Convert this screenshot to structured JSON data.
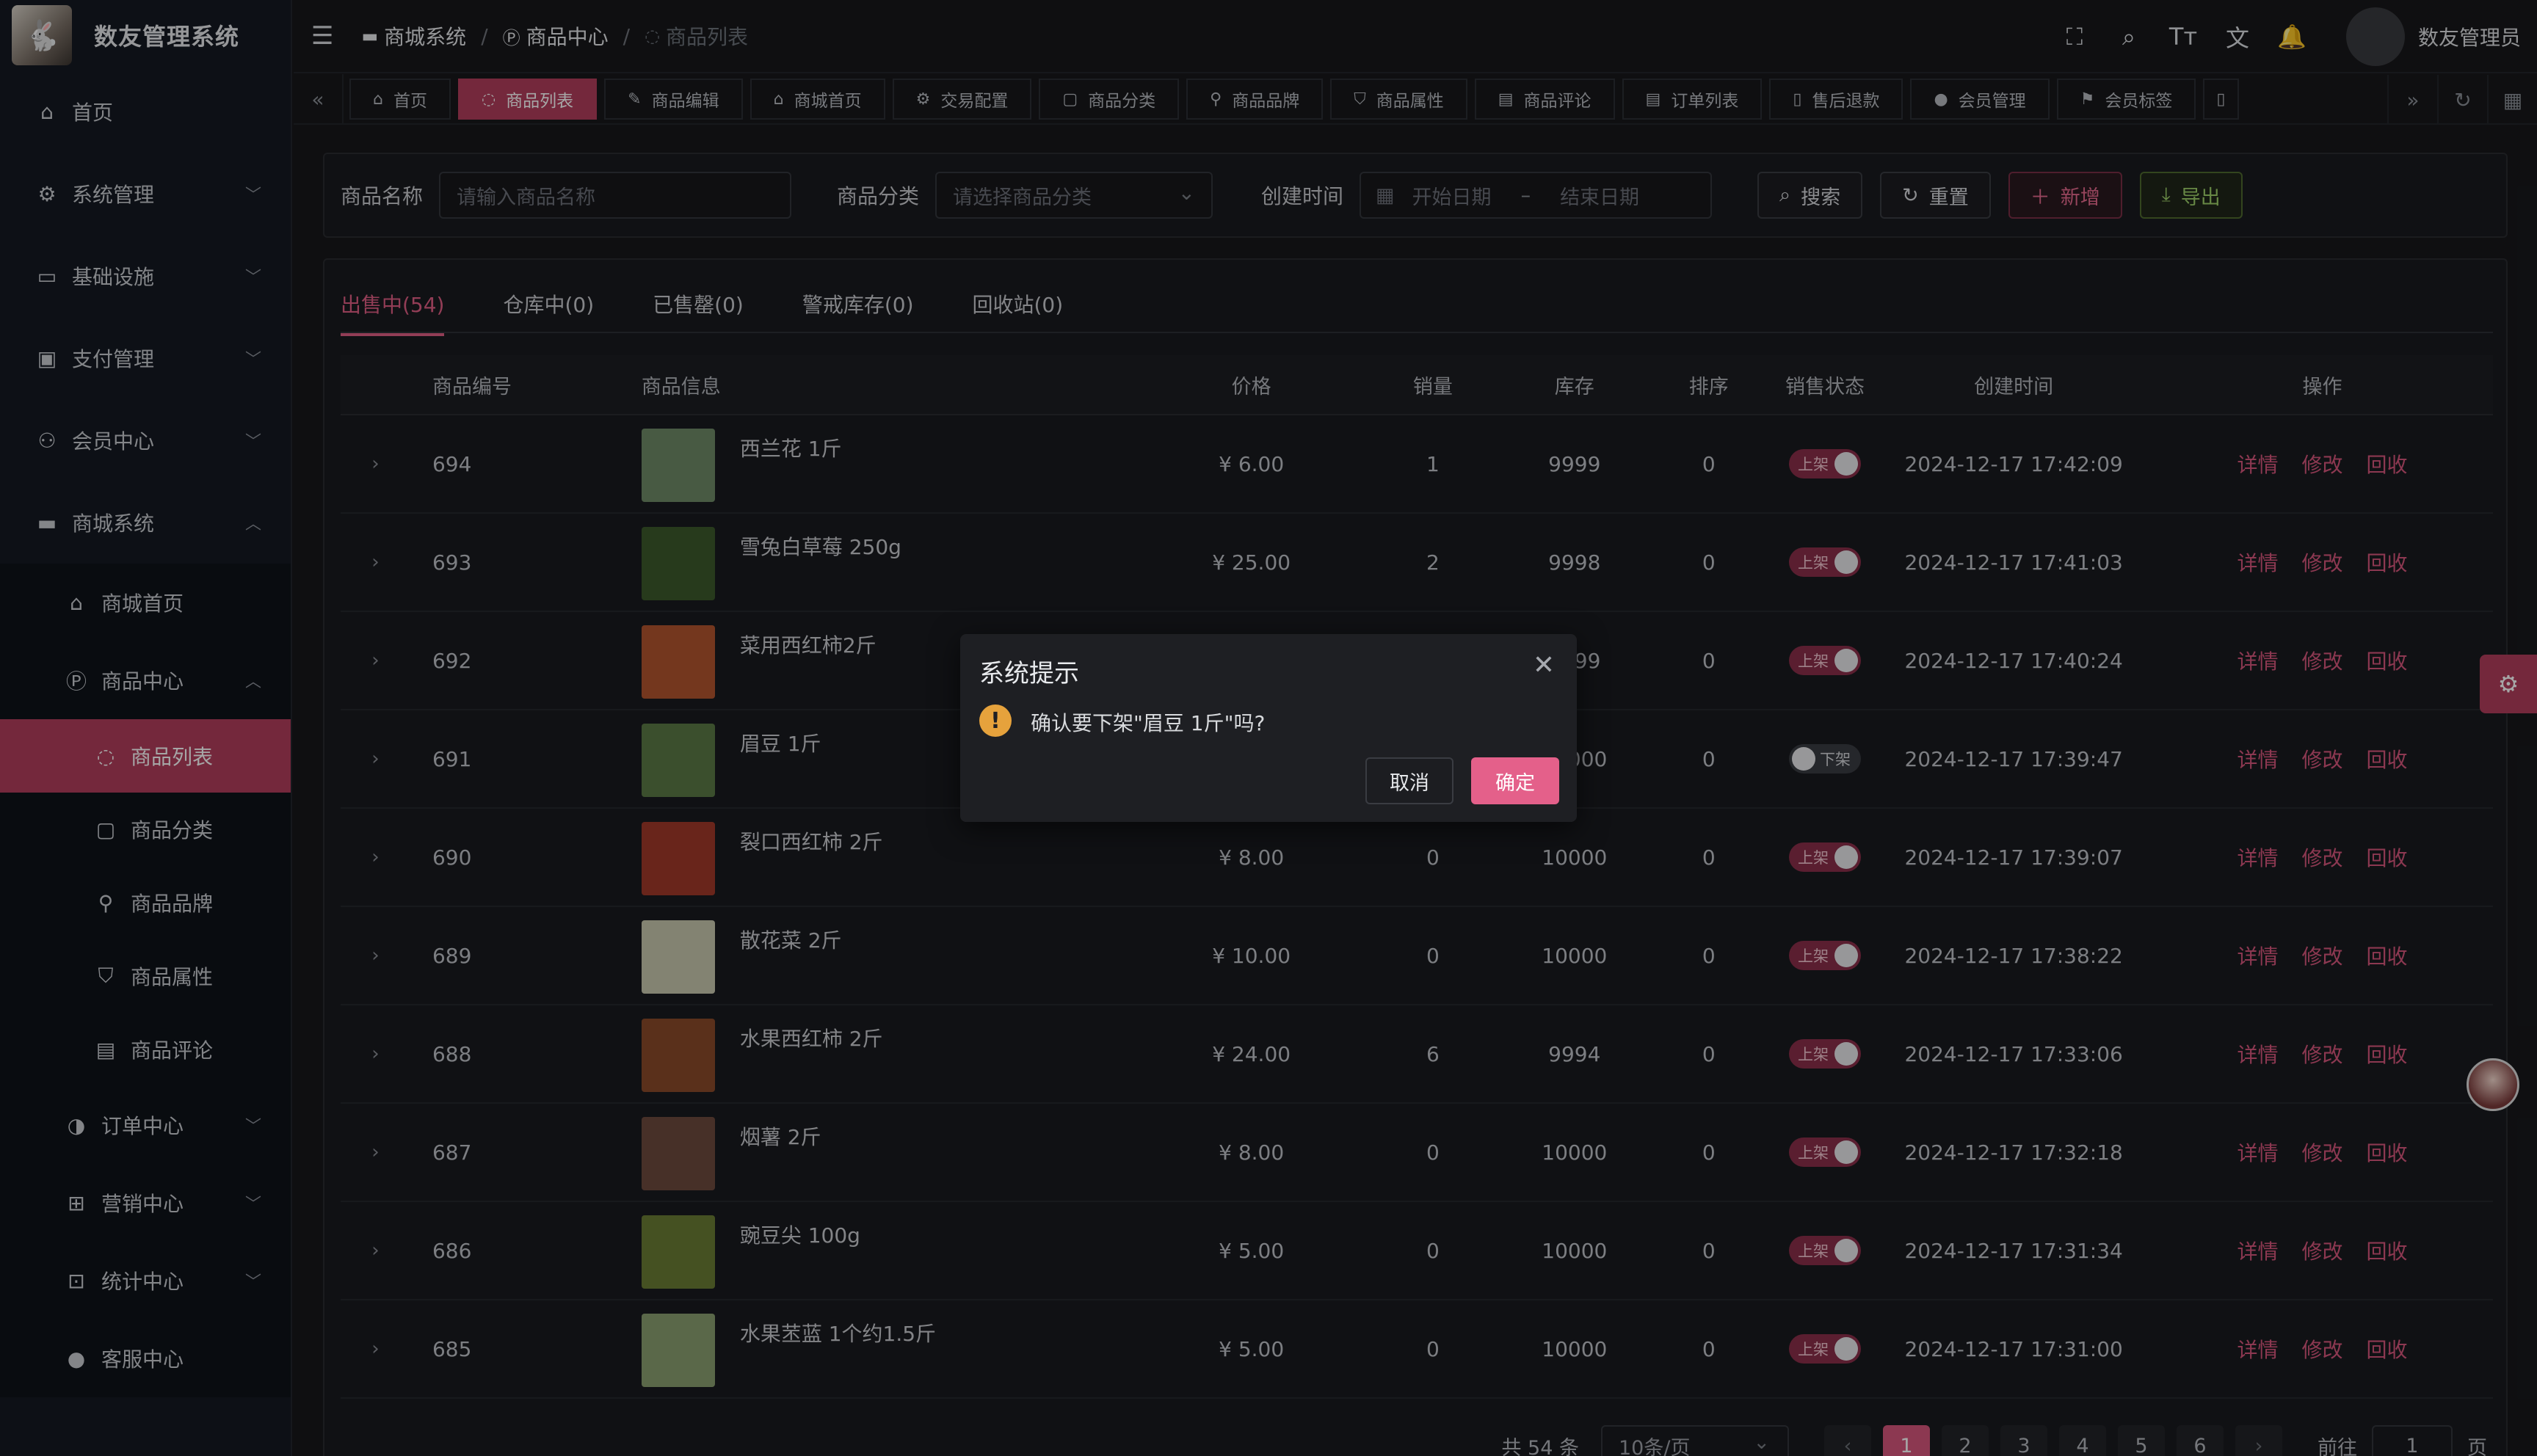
{
  "app": {
    "title": "数友管理系统",
    "logo_icon": "rabbit-logo-icon"
  },
  "sidebar": {
    "items": [
      {
        "label": "首页",
        "icon": "home-icon",
        "glyph": "⌂"
      },
      {
        "label": "系统管理",
        "icon": "gear-icon",
        "glyph": "⚙"
      },
      {
        "label": "基础设施",
        "icon": "monitor-icon",
        "glyph": "▭"
      },
      {
        "label": "支付管理",
        "icon": "wallet-icon",
        "glyph": "▣"
      },
      {
        "label": "会员中心",
        "icon": "users-icon",
        "glyph": "⚇"
      },
      {
        "label": "商城系统",
        "icon": "shop-icon",
        "glyph": "▬"
      }
    ],
    "mall_sub": [
      {
        "label": "商城首页",
        "icon": "home-icon",
        "glyph": "⌂"
      },
      {
        "label": "商品中心",
        "icon": "product-p-icon",
        "glyph": "Ⓟ"
      }
    ],
    "product_sub": [
      {
        "label": "商品列表",
        "icon": "loading-icon",
        "glyph": "◌"
      },
      {
        "label": "商品分类",
        "icon": "category-icon",
        "glyph": "▢"
      },
      {
        "label": "商品品牌",
        "icon": "link-icon",
        "glyph": "⚲"
      },
      {
        "label": "商品属性",
        "icon": "filter-icon",
        "glyph": "⛉"
      },
      {
        "label": "商品评论",
        "icon": "comment-icon",
        "glyph": "▤"
      }
    ],
    "mall_sub2": [
      {
        "label": "订单中心",
        "icon": "order-icon",
        "glyph": "◑"
      },
      {
        "label": "营销中心",
        "icon": "gift-icon",
        "glyph": "⊞"
      },
      {
        "label": "统计中心",
        "icon": "chart-icon",
        "glyph": "⊡"
      },
      {
        "label": "客服中心",
        "icon": "user-icon",
        "glyph": "●"
      }
    ]
  },
  "breadcrumb": [
    {
      "label": "商城系统",
      "icon": "shop-icon",
      "glyph": "▬"
    },
    {
      "label": "商品中心",
      "icon": "product-p-icon",
      "glyph": "Ⓟ"
    },
    {
      "label": "商品列表",
      "icon": "loading-icon",
      "glyph": "◌"
    }
  ],
  "header": {
    "username": "数友管理员"
  },
  "tabs": [
    {
      "label": "首页",
      "glyph": "⌂"
    },
    {
      "label": "商品列表",
      "glyph": "◌"
    },
    {
      "label": "商品编辑",
      "glyph": "✎"
    },
    {
      "label": "商城首页",
      "glyph": "⌂"
    },
    {
      "label": "交易配置",
      "glyph": "⚙"
    },
    {
      "label": "商品分类",
      "glyph": "▢"
    },
    {
      "label": "商品品牌",
      "glyph": "⚲"
    },
    {
      "label": "商品属性",
      "glyph": "⛉"
    },
    {
      "label": "商品评论",
      "glyph": "▤"
    },
    {
      "label": "订单列表",
      "glyph": "▤"
    },
    {
      "label": "售后退款",
      "glyph": "▯"
    },
    {
      "label": "会员管理",
      "glyph": "●"
    },
    {
      "label": "会员标签",
      "glyph": "⚑"
    },
    {
      "label": "",
      "glyph": "▯"
    }
  ],
  "search": {
    "name_label": "商品名称",
    "name_placeholder": "请输入商品名称",
    "category_label": "商品分类",
    "category_placeholder": "请选择商品分类",
    "time_label": "创建时间",
    "start_placeholder": "开始日期",
    "range_sep": "–",
    "end_placeholder": "结束日期",
    "search_btn": "搜索",
    "reset_btn": "重置",
    "add_btn": "新增",
    "export_btn": "导出"
  },
  "status_tabs": [
    {
      "label": "出售中(54)"
    },
    {
      "label": "仓库中(0)"
    },
    {
      "label": "已售罄(0)"
    },
    {
      "label": "警戒库存(0)"
    },
    {
      "label": "回收站(0)"
    }
  ],
  "table": {
    "headers": {
      "id": "商品编号",
      "info": "商品信息",
      "price": "价格",
      "sales": "销量",
      "stock": "库存",
      "sort": "排序",
      "status": "销售状态",
      "time": "创建时间",
      "ops": "操作"
    },
    "ops": {
      "detail": "详情",
      "edit": "修改",
      "recycle": "回收"
    },
    "status_on": "上架",
    "status_off": "下架",
    "rows": [
      {
        "id": "694",
        "name": "西兰花 1斤",
        "price": "¥ 6.00",
        "sales": "1",
        "stock": "9999",
        "sort": "0",
        "on": true,
        "time": "2024-12-17 17:42:09",
        "thumb": "#6f8a68"
      },
      {
        "id": "693",
        "name": "雪兔白草莓 250g",
        "price": "¥ 25.00",
        "sales": "2",
        "stock": "9998",
        "sort": "0",
        "on": true,
        "time": "2024-12-17 17:41:03",
        "thumb": "#3d5a2c"
      },
      {
        "id": "692",
        "name": "菜用西红柿2斤",
        "price": "",
        "sales": "",
        "stock": "9999",
        "sort": "0",
        "on": true,
        "time": "2024-12-17 17:40:24",
        "thumb": "#b2552e"
      },
      {
        "id": "691",
        "name": "眉豆 1斤",
        "price": "",
        "sales": "",
        "stock": "10000",
        "sort": "0",
        "on": false,
        "time": "2024-12-17 17:39:47",
        "thumb": "#5b7a45"
      },
      {
        "id": "690",
        "name": "裂口西红柿 2斤",
        "price": "¥ 8.00",
        "sales": "0",
        "stock": "10000",
        "sort": "0",
        "on": true,
        "time": "2024-12-17 17:39:07",
        "thumb": "#a23a2a"
      },
      {
        "id": "689",
        "name": "散花菜 2斤",
        "price": "¥ 10.00",
        "sales": "0",
        "stock": "10000",
        "sort": "0",
        "on": true,
        "time": "2024-12-17 17:38:22",
        "thumb": "#c9c9b0"
      },
      {
        "id": "688",
        "name": "水果西红柿 2斤",
        "price": "¥ 24.00",
        "sales": "6",
        "stock": "9994",
        "sort": "0",
        "on": true,
        "time": "2024-12-17 17:33:06",
        "thumb": "#8a4a2a"
      },
      {
        "id": "687",
        "name": "烟薯 2斤",
        "price": "¥ 8.00",
        "sales": "0",
        "stock": "10000",
        "sort": "0",
        "on": true,
        "time": "2024-12-17 17:32:18",
        "thumb": "#6e4a3e"
      },
      {
        "id": "686",
        "name": "豌豆尖 100g",
        "price": "¥ 5.00",
        "sales": "0",
        "stock": "10000",
        "sort": "0",
        "on": true,
        "time": "2024-12-17 17:31:34",
        "thumb": "#6b7d35"
      },
      {
        "id": "685",
        "name": "水果苤蓝 1个约1.5斤",
        "price": "¥ 5.00",
        "sales": "0",
        "stock": "10000",
        "sort": "0",
        "on": true,
        "time": "2024-12-17 17:31:00",
        "thumb": "#8aa070"
      }
    ]
  },
  "pagination": {
    "total": "共 54 条",
    "page_size": "10条/页",
    "pages": [
      "1",
      "2",
      "3",
      "4",
      "5",
      "6"
    ],
    "prev": "‹",
    "next": "›",
    "goto": "前往",
    "goto_value": "1",
    "page_unit": "页"
  },
  "dialog": {
    "title": "系统提示",
    "message": "确认要下架\"眉豆 1斤\"吗?",
    "warn": "!",
    "close": "✕",
    "cancel": "取消",
    "confirm": "确定"
  },
  "colors": {
    "accent": "#b33e5c",
    "link": "#d8577d",
    "warn": "#e6a23c"
  }
}
